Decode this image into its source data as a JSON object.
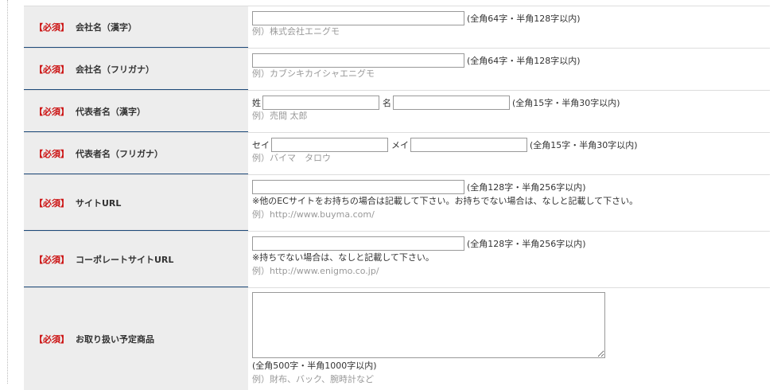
{
  "required_badge": "【必須】",
  "rows": [
    {
      "label": "会社名（漢字）",
      "input_value": "",
      "limit": "(全角64字・半角128字以内)",
      "example": "例）株式会社エニグモ"
    },
    {
      "label": "会社名（フリガナ）",
      "input_value": "",
      "limit": "(全角64字・半角128字以内)",
      "example": "例）カブシキカイシャエニグモ"
    },
    {
      "label": "代表者名（漢字）",
      "first_label": "姓",
      "second_label": "名",
      "limit": "(全角15字・半角30字以内)",
      "example": "例）売間 太郎"
    },
    {
      "label": "代表者名（フリガナ）",
      "first_label": "セイ",
      "second_label": "メイ",
      "limit": "(全角15字・半角30字以内)",
      "example": "例）バイマ　タロウ"
    },
    {
      "label": "サイトURL",
      "input_value": "",
      "limit": "(全角128字・半角256字以内)",
      "note": "※他のECサイトをお持ちの場合は記載して下さい。お持ちでない場合は、なしと記載して下さい。",
      "example": "例）http://www.buyma.com/"
    },
    {
      "label": "コーポレートサイトURL",
      "input_value": "",
      "limit": "(全角128字・半角256字以内)",
      "note": "※持ちでない場合は、なしと記載して下さい。",
      "example": "例）http://www.enigmo.co.jp/"
    },
    {
      "label": "お取り扱い予定商品",
      "limit": "(全角500字・半角1000字以内)",
      "example": "例）財布、バック、腕時計など"
    }
  ]
}
